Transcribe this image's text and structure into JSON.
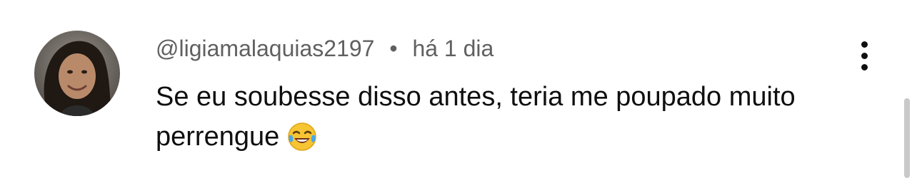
{
  "comment": {
    "author_handle": "@ligiamalaquias2197",
    "separator": "•",
    "time_ago": "há 1 dia",
    "text": "Se eu soubesse disso antes, teria me poupado muito perrengue",
    "emoji_icon": "tears-of-joy-emoji",
    "avatar_icon": "user-avatar-photo",
    "more_icon": "vertical-ellipsis-icon"
  },
  "colors": {
    "meta_text": "#606060",
    "body_text": "#0f0f0f",
    "background": "#ffffff",
    "scrollbar": "#c9c9c9"
  }
}
